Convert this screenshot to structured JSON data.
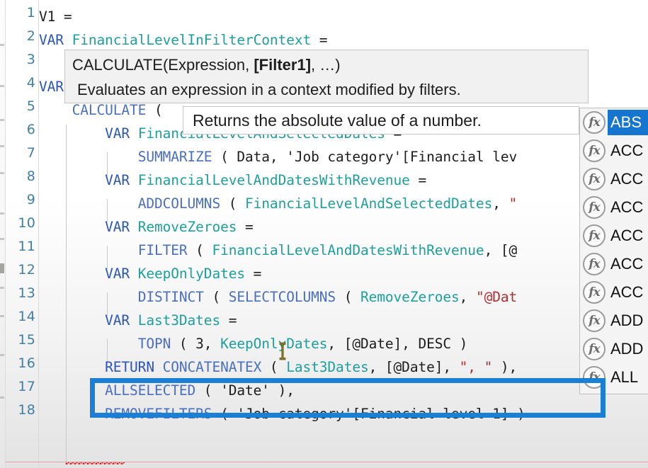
{
  "app": {
    "kind": "dax-formula-editor",
    "colors": {
      "keyword": "#2b56b8",
      "function": "#4a6fbf",
      "variable": "#1f9e9e",
      "string": "#b03030",
      "plain": "#1d1d1d",
      "selection_blue": "#1675cf",
      "annotation_blue": "#1b7fd6",
      "gutter_number": "#3f7fa6",
      "error_squiggle": "#e02020"
    }
  },
  "editor": {
    "line_numbers": [
      "1",
      "2",
      "3",
      "4",
      "5",
      "6",
      "7",
      "8",
      "9",
      "10",
      "11",
      "12",
      "13",
      "14",
      "15",
      "16",
      "17",
      "18"
    ],
    "lines": [
      {
        "number": "1",
        "text": "V1 =",
        "tokens": [
          {
            "t": "V1",
            "c": "plain"
          },
          {
            "t": " ",
            "c": "plain"
          },
          {
            "t": "=",
            "c": "plain"
          }
        ]
      },
      {
        "number": "2",
        "text": "VAR FinancialLevelInFilterContext =",
        "tokens": [
          {
            "t": "VAR ",
            "c": "kw"
          },
          {
            "t": "FinancialLevelInFilterContext",
            "c": "var"
          },
          {
            "t": " =",
            "c": "plain"
          }
        ]
      },
      {
        "number": "3",
        "text": "",
        "tokens": []
      },
      {
        "number": "4",
        "text": "VAR",
        "tokens": [
          {
            "t": "VAR",
            "c": "kw"
          }
        ]
      },
      {
        "number": "5",
        "text": "    CALCULATE (",
        "tokens": [
          {
            "t": "    ",
            "c": "plain"
          },
          {
            "t": "CALCULATE",
            "c": "fn"
          },
          {
            "t": " (",
            "c": "plain"
          }
        ]
      },
      {
        "number": "6",
        "text": "        VAR FinancialLevelAndSelectedDates =",
        "tokens": [
          {
            "t": "        ",
            "c": "plain"
          },
          {
            "t": "VAR ",
            "c": "kw"
          },
          {
            "t": "FinancialLevelAndSelectedDates",
            "c": "var"
          },
          {
            "t": " =",
            "c": "plain"
          }
        ]
      },
      {
        "number": "7",
        "text": "            SUMMARIZE ( Data, 'Job category'[Financial lev",
        "tokens": [
          {
            "t": "            ",
            "c": "plain"
          },
          {
            "t": "SUMMARIZE",
            "c": "fn"
          },
          {
            "t": " ( Data, 'Job category'[Financial lev",
            "c": "plain"
          }
        ]
      },
      {
        "number": "8",
        "text": "        VAR FinancialLevelAndDatesWithRevenue =",
        "tokens": [
          {
            "t": "        ",
            "c": "plain"
          },
          {
            "t": "VAR ",
            "c": "kw"
          },
          {
            "t": "FinancialLevelAndDatesWithRevenue",
            "c": "var"
          },
          {
            "t": " =",
            "c": "plain"
          }
        ]
      },
      {
        "number": "9",
        "text": "            ADDCOLUMNS ( FinancialLevelAndSelectedDates, \"",
        "tokens": [
          {
            "t": "            ",
            "c": "plain"
          },
          {
            "t": "ADDCOLUMNS",
            "c": "fn"
          },
          {
            "t": " ( ",
            "c": "plain"
          },
          {
            "t": "FinancialLevelAndSelectedDates",
            "c": "var"
          },
          {
            "t": ", ",
            "c": "plain"
          },
          {
            "t": "\"",
            "c": "str"
          }
        ]
      },
      {
        "number": "10",
        "text": "        VAR RemoveZeroes =",
        "tokens": [
          {
            "t": "        ",
            "c": "plain"
          },
          {
            "t": "VAR ",
            "c": "kw"
          },
          {
            "t": "RemoveZeroes",
            "c": "var"
          },
          {
            "t": " =",
            "c": "plain"
          }
        ]
      },
      {
        "number": "11",
        "text": "            FILTER ( FinancialLevelAndDatesWithRevenue, [@",
        "tokens": [
          {
            "t": "            ",
            "c": "plain"
          },
          {
            "t": "FILTER",
            "c": "fn"
          },
          {
            "t": " ( ",
            "c": "plain"
          },
          {
            "t": "FinancialLevelAndDatesWithRevenue",
            "c": "var"
          },
          {
            "t": ", [@",
            "c": "plain"
          }
        ]
      },
      {
        "number": "12",
        "text": "        VAR KeepOnlyDates =",
        "tokens": [
          {
            "t": "        ",
            "c": "plain"
          },
          {
            "t": "VAR ",
            "c": "kw"
          },
          {
            "t": "KeepOnlyDates",
            "c": "var"
          },
          {
            "t": " =",
            "c": "plain"
          }
        ]
      },
      {
        "number": "13",
        "text": "            DISTINCT ( SELECTCOLUMNS ( RemoveZeroes, \"@Dat",
        "tokens": [
          {
            "t": "            ",
            "c": "plain"
          },
          {
            "t": "DISTINCT",
            "c": "fn"
          },
          {
            "t": " ( ",
            "c": "plain"
          },
          {
            "t": "SELECTCOLUMNS",
            "c": "fn"
          },
          {
            "t": " ( ",
            "c": "plain"
          },
          {
            "t": "RemoveZeroes",
            "c": "var"
          },
          {
            "t": ", ",
            "c": "plain"
          },
          {
            "t": "\"@Dat",
            "c": "str"
          }
        ]
      },
      {
        "number": "14",
        "text": "        VAR Last3Dates =",
        "tokens": [
          {
            "t": "        ",
            "c": "plain"
          },
          {
            "t": "VAR ",
            "c": "kw"
          },
          {
            "t": "Last3Dates",
            "c": "var"
          },
          {
            "t": " =  ",
            "c": "plain"
          }
        ]
      },
      {
        "number": "15",
        "text": "            TOPN ( 3, KeepOnlyDates, [@Date], DESC )",
        "tokens": [
          {
            "t": "            ",
            "c": "plain"
          },
          {
            "t": "TOPN",
            "c": "fn"
          },
          {
            "t": " ( 3, ",
            "c": "plain"
          },
          {
            "t": "KeepOnlyDates",
            "c": "var"
          },
          {
            "t": ", [@Date], DESC )",
            "c": "plain"
          }
        ]
      },
      {
        "number": "16",
        "text": "        RETURN CONCATENATEX ( Last3Dates, [@Date], \", \" ),",
        "tokens": [
          {
            "t": "        ",
            "c": "plain"
          },
          {
            "t": "RETURN ",
            "c": "kw"
          },
          {
            "t": "CONCATENATEX",
            "c": "fn"
          },
          {
            "t": " ( ",
            "c": "plain"
          },
          {
            "t": "Last3Dates",
            "c": "var"
          },
          {
            "t": ", [@Date], ",
            "c": "plain"
          },
          {
            "t": "\", \"",
            "c": "str"
          },
          {
            "t": " ),",
            "c": "plain"
          }
        ]
      },
      {
        "number": "17",
        "text": "        ALLSELECTED ( 'Date' ),",
        "tokens": [
          {
            "t": "        ",
            "c": "plain"
          },
          {
            "t": "ALLSELECTED",
            "c": "fn"
          },
          {
            "t": " ( 'Date' ),",
            "c": "plain"
          }
        ]
      },
      {
        "number": "18",
        "text": "        REMOVEFILTERS ( 'Job category'[Financial level 1] )",
        "tokens": [
          {
            "t": "        ",
            "c": "plain"
          },
          {
            "t": "REMOVEFILTERS",
            "c": "fn"
          },
          {
            "t": " ( 'Job category'[Financial level 1] )",
            "c": "plain"
          }
        ]
      }
    ]
  },
  "signature_tooltip": {
    "signature_prefix": "CALCULATE(Expression, ",
    "signature_bold": "[Filter1]",
    "signature_suffix": ", …)",
    "description": "Evaluates an expression in a context modified by filters."
  },
  "description_tooltip": {
    "text": "Returns the absolute value of a number."
  },
  "autocomplete": {
    "icon_glyph": "fx",
    "items": [
      {
        "label": "ABS",
        "selected": true
      },
      {
        "label": "ACC",
        "selected": false
      },
      {
        "label": "ACC",
        "selected": false
      },
      {
        "label": "ACC",
        "selected": false
      },
      {
        "label": "ACC",
        "selected": false
      },
      {
        "label": "ACC",
        "selected": false
      },
      {
        "label": "ACC",
        "selected": false
      },
      {
        "label": "ADD",
        "selected": false
      },
      {
        "label": "ADD",
        "selected": false
      },
      {
        "label": "ALL",
        "selected": false
      }
    ]
  },
  "annotation": {
    "label": "highlight-rectangle-line-16"
  }
}
